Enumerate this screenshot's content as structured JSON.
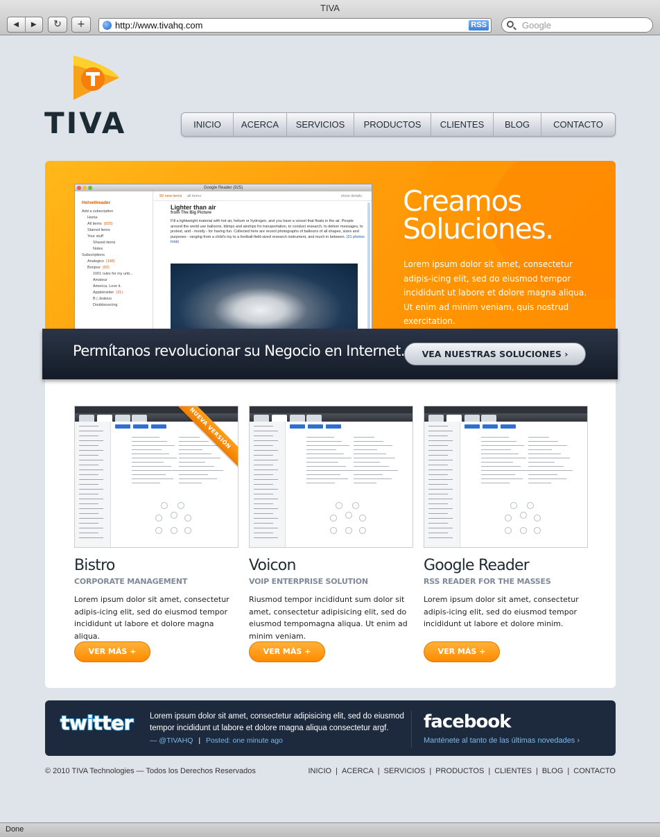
{
  "browser": {
    "window_title": "TIVA",
    "url": "http://www.tivahq.com",
    "rss_label": "RSS",
    "search_placeholder": "Google",
    "status": "Done"
  },
  "logo": {
    "text": "TIVA",
    "accent": "#f99d1c"
  },
  "nav": [
    "INICIO",
    "ACERCA",
    "SERVICIOS",
    "PRODUCTOS",
    "CLIENTES",
    "BLOG",
    "CONTACTO"
  ],
  "hero": {
    "title_line1": "Creamos",
    "title_line2": "Soluciones.",
    "text": "Lorem ipsum dolor sit amet, consectetur adipis-icing elit, sed do eiusmod tempor incididunt ut labore et dolore magna aliqua. Ut enim ad minim veniam, quis nostrud exercitation.",
    "screenshot": {
      "window_title": "Google Reader (925)",
      "brand": "Helvetireader",
      "new_items": "92 new items",
      "all_items": "all items",
      "show_details": "show details",
      "sidebar": [
        {
          "label": "Add a subscription",
          "level": 0
        },
        {
          "label": "Home",
          "level": 1
        },
        {
          "label": "All items",
          "count": "(925)",
          "level": 1
        },
        {
          "label": "Starred items",
          "level": 1
        },
        {
          "label": "Your stuff",
          "level": 1
        },
        {
          "label": "Shared items",
          "level": 2
        },
        {
          "label": "Notes",
          "level": 2
        },
        {
          "label": "Subscriptions",
          "level": 0
        },
        {
          "label": "Analogics",
          "count": "(148)",
          "level": 1
        },
        {
          "label": "Bonjour",
          "count": "(92)",
          "level": 1
        },
        {
          "label": "1001 rules for my unb...",
          "level": 2
        },
        {
          "label": "Amateur",
          "level": 2
        },
        {
          "label": "America. Love it.",
          "level": 2
        },
        {
          "label": "Appleinsider",
          "count": "(31)",
          "level": 2
        },
        {
          "label": "B | Jealous",
          "level": 2
        },
        {
          "label": "Doubtsourcing",
          "level": 2
        }
      ],
      "article_title": "Lighter than air",
      "article_source": "from The Big Picture",
      "article_body": "Fill a lightweight material with hot air, helium or hydrogen, and you have a vessel that floats in the air. People around the world use balloons, blimps and airships for transportation, to conduct research, to deliver messages, to protest, and - mostly - for having fun. Collected here are recent photographs of balloons of all shapes, sizes and purposes - ranging from a child's toy to a football-field-sized research instrument, and much in between.",
      "article_link": "(31 photos total)"
    }
  },
  "band": {
    "text": "Permítanos revolucionar su Negocio en Internet.",
    "button": "VEA NUESTRAS SOLUCIONES ›"
  },
  "products": [
    {
      "title": "Bistro",
      "subtitle": "CORPORATE MANAGEMENT",
      "text": "Lorem ipsum dolor sit amet, consectetur adipis-icing elit, sed do eiusmod tempor incididunt ut labore et dolore magna aliqua.",
      "button": "VER MÁS +",
      "ribbon": "NUEVA VERSIÓN"
    },
    {
      "title": "Voicon",
      "subtitle": "VOIP ENTERPRISE SOLUTION",
      "text": "Riusmod tempor incididunt  sum dolor sit amet, consectetur adipisicing elit, sed do eiusmod tempomagna aliqua. Ut enim ad minim veniam.",
      "button": "VER MÁS +"
    },
    {
      "title": "Google Reader",
      "subtitle": "RSS READER FOR THE MASSES",
      "text": "Lorem ipsum dolor sit amet, consectetur adipis-icing elit, sed do eiusmod tempor incididunt ut labore et dolore minim.",
      "button": "VER MÁS +"
    }
  ],
  "social": {
    "twitter_logo": "twitter",
    "tweet": "Lorem ipsum dolor sit amet, consectetur adipisicing elit, sed do eiusmod tempor incididunt ut labore et dolore magna aliqua consectetur argf.",
    "tweet_handle": "— @TIVAHQ",
    "tweet_separator": "|",
    "tweet_posted": "Posted: one minute ago",
    "facebook_logo": "facebook",
    "facebook_link": "Manténete al tanto de las últimas novedades ›"
  },
  "footer": {
    "copyright": "© 2010 TIVA Technologies — Todos los Derechos Reservados",
    "links": [
      "INICIO",
      "ACERCA",
      "SERVICIOS",
      "PRODUCTOS",
      "CLIENTES",
      "BLOG",
      "CONTACTO"
    ],
    "separator": "|"
  },
  "colors": {
    "orange": "#ff9d0a",
    "navy": "#1d2a3e",
    "background": "#dfe3ea"
  }
}
